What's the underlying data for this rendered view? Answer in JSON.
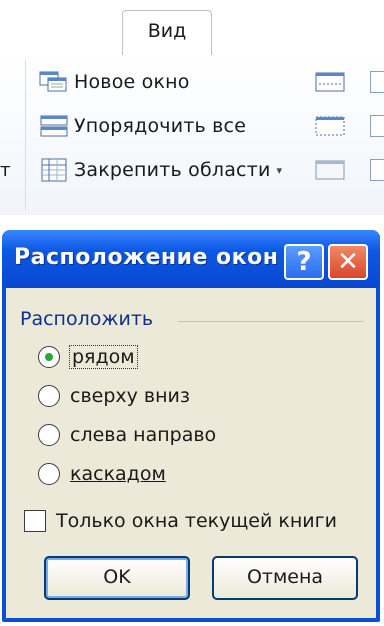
{
  "ribbon": {
    "tab_label": "Вид",
    "clipped_left_text": "т",
    "items": [
      {
        "label": "Новое окно",
        "icon": "new-window-icon"
      },
      {
        "label": "Упорядочить все",
        "icon": "arrange-all-icon"
      },
      {
        "label": "Закрепить области",
        "icon": "freeze-panes-icon",
        "caret": "▾"
      }
    ]
  },
  "dialog": {
    "title": "Расположение окон",
    "help_label": "?",
    "close_label": "✕",
    "group_label": "Расположить",
    "options": [
      {
        "label": "рядом",
        "checked": true
      },
      {
        "label": "сверху вниз",
        "checked": false
      },
      {
        "label": "слева направо",
        "checked": false
      },
      {
        "label": "каскадом",
        "checked": false
      }
    ],
    "checkbox_label": "Только окна текущей книги",
    "checkbox_checked": false,
    "ok_label": "OK",
    "cancel_label": "Отмена"
  },
  "colors": {
    "titlebar": "#0d58e6",
    "dialog_client": "#ece9d8",
    "group_label": "#0f2f8f",
    "close_button": "#d9452a",
    "radio_dot": "#27a830"
  }
}
